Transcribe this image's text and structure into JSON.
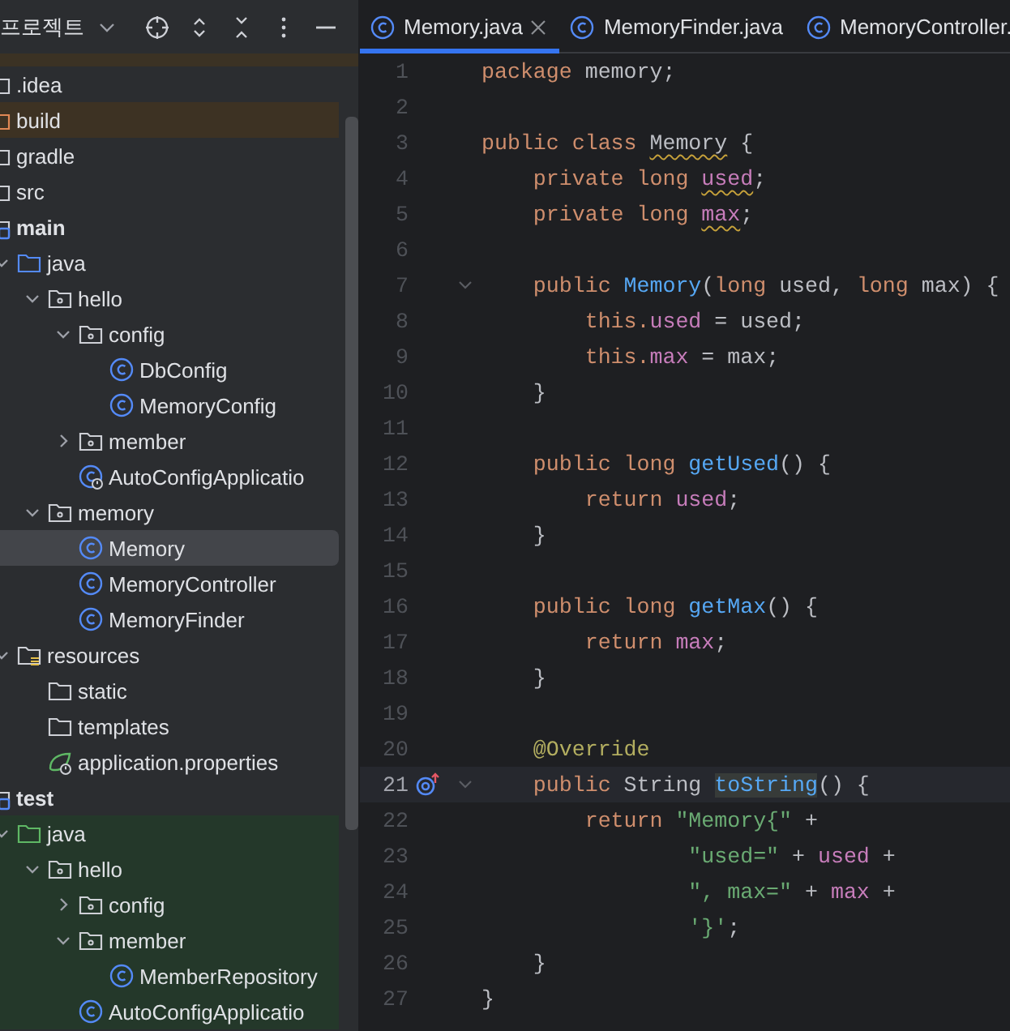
{
  "project_panel": {
    "title": "프로젝트",
    "tree": [
      {
        "label": ".idea",
        "kind": "folder"
      },
      {
        "label": "build",
        "kind": "folder",
        "excluded": true
      },
      {
        "label": "gradle",
        "kind": "folder"
      },
      {
        "label": "src",
        "kind": "folder"
      },
      {
        "label": "main",
        "kind": "module",
        "children": [
          {
            "label": "java",
            "kind": "source",
            "expanded": true,
            "children": [
              {
                "label": "hello",
                "kind": "package",
                "expanded": true,
                "children": [
                  {
                    "label": "config",
                    "kind": "package",
                    "expanded": true,
                    "children": [
                      {
                        "label": "DbConfig",
                        "kind": "class"
                      },
                      {
                        "label": "MemoryConfig",
                        "kind": "class"
                      }
                    ]
                  },
                  {
                    "label": "member",
                    "kind": "package",
                    "expanded": false
                  },
                  {
                    "label": "AutoConfigApplicatio",
                    "kind": "app"
                  }
                ]
              },
              {
                "label": "memory",
                "kind": "package",
                "expanded": true,
                "children": [
                  {
                    "label": "Memory",
                    "kind": "class",
                    "selected": true
                  },
                  {
                    "label": "MemoryController",
                    "kind": "class",
                    "selected": false
                  },
                  {
                    "label": "MemoryFinder",
                    "kind": "class",
                    "selected": false
                  }
                ]
              }
            ]
          },
          {
            "label": "resources",
            "kind": "resources",
            "expanded": true,
            "children": [
              {
                "label": "static",
                "kind": "folder"
              },
              {
                "label": "templates",
                "kind": "folder"
              },
              {
                "label": "application.properties",
                "kind": "properties"
              }
            ]
          }
        ]
      },
      {
        "label": "test",
        "kind": "module",
        "children": [
          {
            "label": "java",
            "kind": "test",
            "expanded": true,
            "children": [
              {
                "label": "hello",
                "kind": "package",
                "expanded": true,
                "children": [
                  {
                    "label": "config",
                    "kind": "package",
                    "expanded": false
                  },
                  {
                    "label": "member",
                    "kind": "package",
                    "expanded": true,
                    "children": [
                      {
                        "label": "MemberRepository",
                        "kind": "class"
                      }
                    ]
                  },
                  {
                    "label": "AutoConfigApplicatio",
                    "kind": "class"
                  }
                ]
              }
            ]
          }
        ]
      }
    ]
  },
  "tabs": [
    {
      "label": "Memory.java",
      "selected": true,
      "closable": true
    },
    {
      "label": "MemoryFinder.java",
      "selected": false
    },
    {
      "label": "MemoryController.",
      "selected": false
    }
  ],
  "code_lines": [
    {
      "n": "1",
      "tokens": [
        {
          "t": "package ",
          "kind": "kw"
        },
        {
          "t": "memory;",
          "kind": "plain"
        }
      ]
    },
    {
      "n": "2"
    },
    {
      "n": "3",
      "tokens": [
        {
          "t": "public class ",
          "kind": "kw"
        },
        {
          "t": "Memory",
          "kind": "plain",
          "warn": true
        },
        {
          "t": " {",
          "kind": "plain"
        }
      ]
    },
    {
      "n": "4",
      "tokens": [
        {
          "t": "    private long ",
          "kind": "kw"
        },
        {
          "t": "used",
          "kind": "field",
          "warn": true
        },
        {
          "t": ";",
          "kind": "plain"
        }
      ]
    },
    {
      "n": "5",
      "tokens": [
        {
          "t": "    private long ",
          "kind": "kw"
        },
        {
          "t": "max",
          "kind": "field",
          "warn": true
        },
        {
          "t": ";",
          "kind": "plain"
        }
      ]
    },
    {
      "n": "6"
    },
    {
      "n": "7",
      "fold": true,
      "tokens": [
        {
          "t": "    public ",
          "kind": "kw"
        },
        {
          "t": "Memory",
          "kind": "fn"
        },
        {
          "t": "(",
          "kind": "plain"
        },
        {
          "t": "long ",
          "kind": "kw"
        },
        {
          "t": "used, ",
          "kind": "plain"
        },
        {
          "t": "long ",
          "kind": "kw"
        },
        {
          "t": "max) {",
          "kind": "plain"
        }
      ]
    },
    {
      "n": "8",
      "tokens": [
        {
          "t": "        this.",
          "kind": "kw"
        },
        {
          "t": "used",
          "kind": "field"
        },
        {
          "t": " = used;",
          "kind": "plain"
        }
      ]
    },
    {
      "n": "9",
      "tokens": [
        {
          "t": "        this.",
          "kind": "kw"
        },
        {
          "t": "max",
          "kind": "field"
        },
        {
          "t": " = max;",
          "kind": "plain"
        }
      ]
    },
    {
      "n": "10",
      "tokens": [
        {
          "t": "    }",
          "kind": "plain"
        }
      ]
    },
    {
      "n": "11"
    },
    {
      "n": "12",
      "tokens": [
        {
          "t": "    public long ",
          "kind": "kw"
        },
        {
          "t": "getUsed",
          "kind": "fn"
        },
        {
          "t": "() {",
          "kind": "plain"
        }
      ]
    },
    {
      "n": "13",
      "tokens": [
        {
          "t": "        return ",
          "kind": "kw"
        },
        {
          "t": "used",
          "kind": "field"
        },
        {
          "t": ";",
          "kind": "plain"
        }
      ]
    },
    {
      "n": "14",
      "tokens": [
        {
          "t": "    }",
          "kind": "plain"
        }
      ]
    },
    {
      "n": "15"
    },
    {
      "n": "16",
      "tokens": [
        {
          "t": "    public long ",
          "kind": "kw"
        },
        {
          "t": "getMax",
          "kind": "fn"
        },
        {
          "t": "() {",
          "kind": "plain"
        }
      ]
    },
    {
      "n": "17",
      "tokens": [
        {
          "t": "        return ",
          "kind": "kw"
        },
        {
          "t": "max",
          "kind": "field"
        },
        {
          "t": ";",
          "kind": "plain"
        }
      ]
    },
    {
      "n": "18",
      "tokens": [
        {
          "t": "    }",
          "kind": "plain"
        }
      ]
    },
    {
      "n": "19"
    },
    {
      "n": "20",
      "tokens": [
        {
          "t": "    @Override",
          "kind": "ann"
        }
      ]
    },
    {
      "n": "21",
      "current": true,
      "override": true,
      "fold": true,
      "tokens": [
        {
          "t": "    public ",
          "kind": "kw"
        },
        {
          "t": "String ",
          "kind": "plain"
        },
        {
          "t": "toString",
          "kind": "fn",
          "highlighted": true
        },
        {
          "t": "() {",
          "kind": "plain"
        }
      ]
    },
    {
      "n": "22",
      "tokens": [
        {
          "t": "        return ",
          "kind": "kw"
        },
        {
          "t": "\"Memory{\"",
          "kind": "string"
        },
        {
          "t": " +",
          "kind": "plain"
        }
      ]
    },
    {
      "n": "23",
      "tokens": [
        {
          "t": "                \"used=\"",
          "kind": "string"
        },
        {
          "t": " + ",
          "kind": "plain"
        },
        {
          "t": "used",
          "kind": "field"
        },
        {
          "t": " +",
          "kind": "plain"
        }
      ]
    },
    {
      "n": "24",
      "tokens": [
        {
          "t": "                \", max=\"",
          "kind": "string"
        },
        {
          "t": " + ",
          "kind": "plain"
        },
        {
          "t": "max",
          "kind": "field"
        },
        {
          "t": " +",
          "kind": "plain"
        }
      ]
    },
    {
      "n": "25",
      "tokens": [
        {
          "t": "                '}'",
          "kind": "string"
        },
        {
          "t": ";",
          "kind": "plain"
        }
      ]
    },
    {
      "n": "26",
      "tokens": [
        {
          "t": "    }",
          "kind": "plain"
        }
      ]
    },
    {
      "n": "27",
      "tokens": [
        {
          "t": "}",
          "kind": "plain"
        }
      ]
    }
  ]
}
